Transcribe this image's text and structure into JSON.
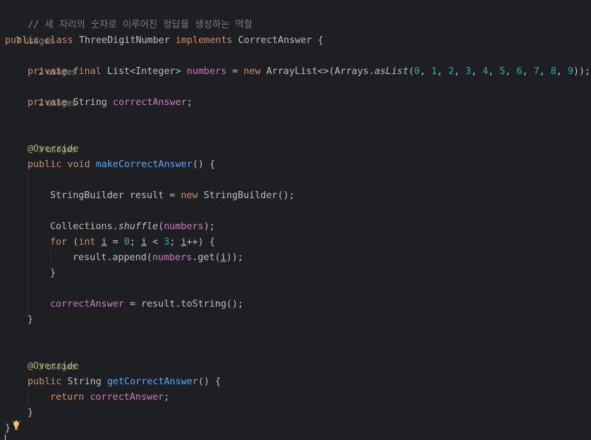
{
  "comment": "// 세 자리의 숫자로 이루어진 정답을 생성하는 역할",
  "usages": {
    "class": "7 usages",
    "numbers": "2 usages",
    "correct_answer_field": "2 usages",
    "make_method": "3 usages",
    "get_method": "3 usages"
  },
  "class_decl": {
    "kw_public": "public",
    "kw_class": "class",
    "name": "ThreeDigitNumber",
    "kw_implements": "implements",
    "iface": "CorrectAnswer",
    "brace": "{"
  },
  "numbers_line": {
    "private": "private",
    "final": "final",
    "type": "List<Integer>",
    "field": "numbers",
    "eq": "=",
    "new": "new",
    "ctor": "ArrayList<>(Arrays.",
    "method": "asList",
    "open": "(",
    "values": [
      "0",
      "1",
      "2",
      "3",
      "4",
      "5",
      "6",
      "7",
      "8",
      "9"
    ],
    "close": "));"
  },
  "answer_field_line": {
    "private": "private",
    "type": "String",
    "field": "correctAnswer",
    "semi": ";"
  },
  "override": "@Override",
  "make_method": {
    "public": "public",
    "void": "void",
    "name": "makeCorrectAnswer",
    "rest": "() {",
    "sb_decl": "StringBuilder result =",
    "new": "new",
    "sb_ctor": "StringBuilder();",
    "shuffle_pre": "Collections.",
    "shuffle": "shuffle",
    "shuffle_open": "(",
    "shuffle_arg": "numbers",
    "shuffle_close": ");",
    "for": "for",
    "int": "int",
    "i": "i",
    "zero": "0",
    "three": "3",
    "append_pre": "result.append(",
    "numbers": "numbers",
    "get": ".get(",
    "append_close": "));",
    "for_close": "}",
    "assign_field": "correctAnswer",
    "assign_rest": "= result.toString();",
    "close": "}"
  },
  "get_method": {
    "public": "public",
    "type": "String",
    "name": "getCorrectAnswer",
    "rest": "() {",
    "return": "return",
    "field": "correctAnswer",
    "semi": ";",
    "close": "}"
  },
  "class_close": "}",
  "icons": [
    "lightbulb-icon"
  ],
  "colors": {
    "background": "#1e1f22",
    "keyword": "#cf8e6d",
    "field": "#c77dbb",
    "method": "#56a8f5",
    "number": "#2aacb8",
    "annotation": "#b3ae60",
    "comment": "#7a7e85",
    "text": "#bcbec4",
    "hint": "#868a91"
  }
}
